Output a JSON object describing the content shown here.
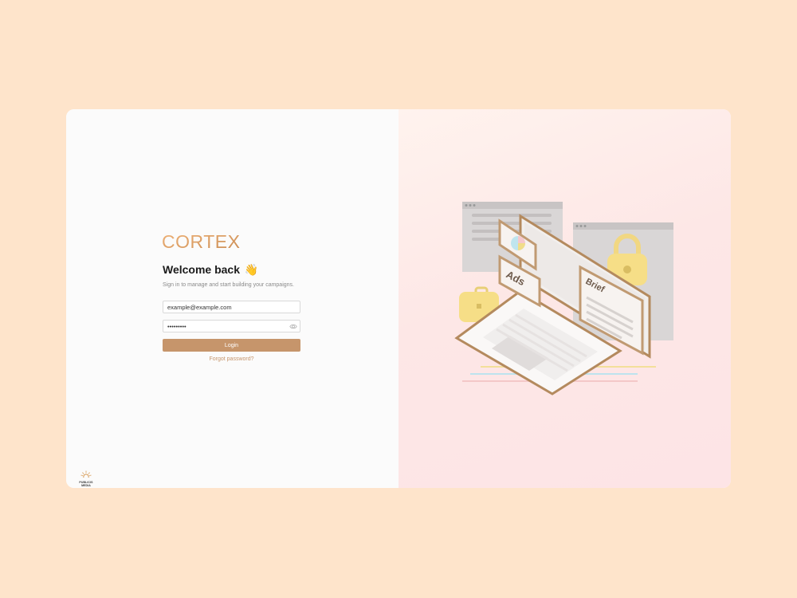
{
  "brand": {
    "logo_text": "CORTEX",
    "footer_text_line1": "PUBLICIS",
    "footer_text_line2": "MEDIA"
  },
  "login": {
    "title": "Welcome back",
    "wave_emoji": "👋",
    "subtitle": "Sign in to manage and start building your campaigns.",
    "email_value": "example@example.com",
    "password_value": "•••••••••",
    "login_label": "Login",
    "forgot_label": "Forgot password?"
  },
  "illustration": {
    "ads_label": "Ads",
    "brief_label": "Brief"
  },
  "colors": {
    "accent": "#c6956b",
    "background": "#fee4cb",
    "panel": "#fbfbfb"
  }
}
